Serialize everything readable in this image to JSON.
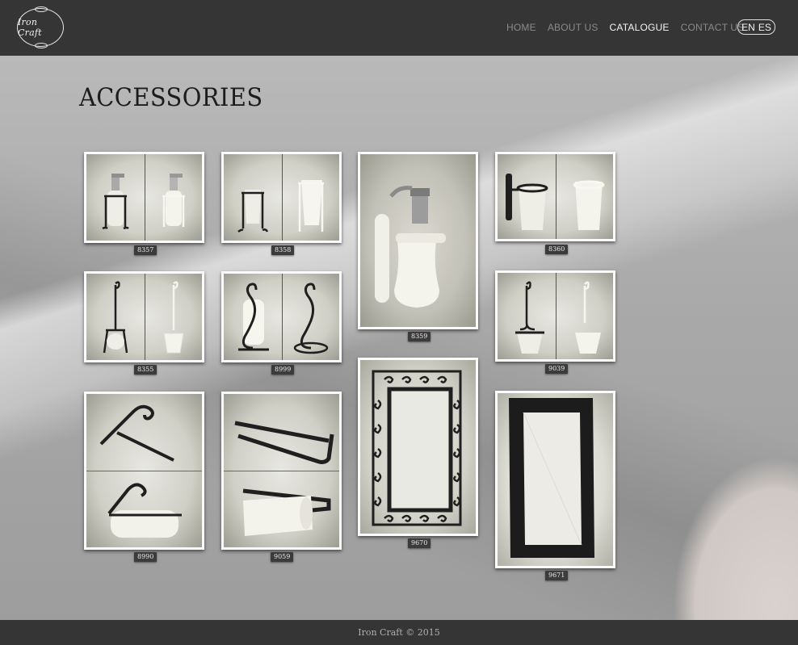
{
  "header": {
    "logo_text": "Iron Craft",
    "nav": [
      {
        "label": "HOME",
        "active": false
      },
      {
        "label": "ABOUT US",
        "active": false
      },
      {
        "label": "CATALOGUE",
        "active": true
      },
      {
        "label": "CONTACT US",
        "active": false
      }
    ],
    "languages": [
      "EN",
      "ES"
    ]
  },
  "page": {
    "title": "ACCESSORIES"
  },
  "products": [
    {
      "code": "8357",
      "icon": "soap-dispenser-icon"
    },
    {
      "code": "8358",
      "icon": "tumbler-holder-icon"
    },
    {
      "code": "8359",
      "icon": "wall-soap-dispenser-icon"
    },
    {
      "code": "8360",
      "icon": "wall-tumbler-holder-icon"
    },
    {
      "code": "8355",
      "icon": "standing-toilet-brush-icon"
    },
    {
      "code": "8999",
      "icon": "paper-roll-stand-icon"
    },
    {
      "code": "9039",
      "icon": "wall-toilet-brush-icon"
    },
    {
      "code": "8990",
      "icon": "paper-towel-holder-icon"
    },
    {
      "code": "9059",
      "icon": "towel-bar-icon"
    },
    {
      "code": "9670",
      "icon": "scroll-mirror-icon"
    },
    {
      "code": "9671",
      "icon": "framed-mirror-icon"
    }
  ],
  "footer": {
    "copyright": "Iron Craft © 2015"
  }
}
